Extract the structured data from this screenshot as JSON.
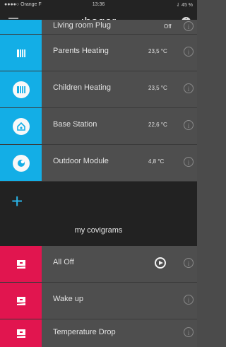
{
  "statusbar": {
    "carrier": "●●●●○ Orange F",
    "time": "13:36",
    "battery": "⇃ 45 %"
  },
  "navbar": {
    "logo": ":hager"
  },
  "devices": [
    {
      "label": "Living room Plug",
      "value": "Off"
    },
    {
      "label": "Parents Heating",
      "value": "23,5 °C"
    },
    {
      "label": "Children Heating",
      "value": "23,5 °C"
    },
    {
      "label": "Base Station",
      "value": "22,6 °C"
    },
    {
      "label": "Outdoor Module",
      "value": "4,8 °C"
    }
  ],
  "section": {
    "title": "my covigrams"
  },
  "covigrams": [
    {
      "label": "All Off"
    },
    {
      "label": "Wake up"
    },
    {
      "label": "Temperature Drop"
    }
  ],
  "colors": {
    "blue": "#13aee6",
    "pink": "#e1154f"
  }
}
